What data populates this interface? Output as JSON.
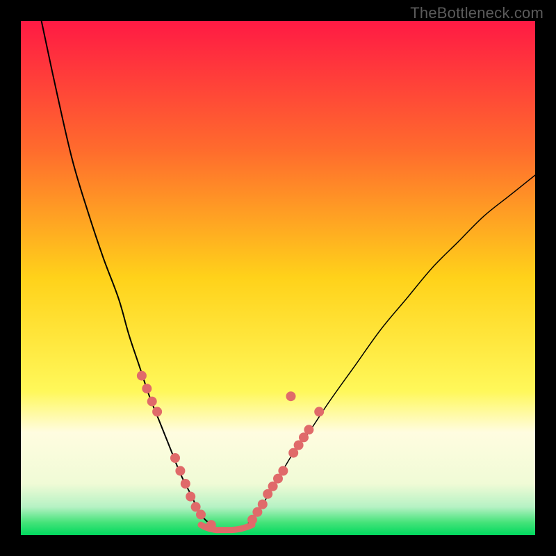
{
  "watermark": "TheBottleneck.com",
  "chart_data": {
    "type": "line",
    "title": "",
    "xlabel": "",
    "ylabel": "",
    "xlim": [
      0,
      100
    ],
    "ylim": [
      0,
      100
    ],
    "grid": false,
    "legend": false,
    "background_gradient": {
      "plot_area_only": true,
      "stops": [
        {
          "position": 0.0,
          "color": "#ff1a44"
        },
        {
          "position": 0.25,
          "color": "#ff6b2d"
        },
        {
          "position": 0.5,
          "color": "#ffd21a"
        },
        {
          "position": 0.72,
          "color": "#fff85a"
        },
        {
          "position": 0.8,
          "color": "#fffce0"
        },
        {
          "position": 0.9,
          "color": "#f0fbd6"
        },
        {
          "position": 0.945,
          "color": "#b6f2c4"
        },
        {
          "position": 0.975,
          "color": "#46e37a"
        },
        {
          "position": 1.0,
          "color": "#00d95e"
        }
      ]
    },
    "series": [
      {
        "name": "left-curve",
        "type": "line",
        "color": "#000000",
        "width": 2,
        "x": [
          4,
          7,
          10,
          13,
          16,
          19,
          21,
          23,
          25,
          27,
          29,
          31,
          33,
          35,
          37
        ],
        "y": [
          100,
          86,
          73,
          63,
          54,
          46,
          39,
          33,
          27,
          22,
          17,
          12,
          8,
          4,
          2
        ]
      },
      {
        "name": "right-curve",
        "type": "line",
        "color": "#000000",
        "width": 1.5,
        "x": [
          44,
          47,
          50,
          53,
          56,
          60,
          65,
          70,
          75,
          80,
          85,
          90,
          95,
          100
        ],
        "y": [
          2,
          6,
          11,
          16,
          20,
          26,
          33,
          40,
          46,
          52,
          57,
          62,
          66,
          70
        ]
      },
      {
        "name": "valley-floor",
        "type": "line",
        "color": "#e06a6a",
        "width": 9,
        "x": [
          35,
          36,
          37,
          38,
          39,
          40,
          41,
          42,
          43,
          44,
          45
        ],
        "y": [
          2,
          1.5,
          1.2,
          1,
          1,
          1,
          1,
          1.1,
          1.3,
          1.6,
          2
        ]
      },
      {
        "name": "left-dots",
        "type": "scatter",
        "color": "#e06a6a",
        "marker_radius": 7,
        "x": [
          23.5,
          24.5,
          25.5,
          26.5,
          30,
          31,
          32,
          33,
          34,
          35,
          37
        ],
        "y": [
          31,
          28.5,
          26,
          24,
          15,
          12.5,
          10,
          7.5,
          5.5,
          4,
          2
        ]
      },
      {
        "name": "right-dots",
        "type": "scatter",
        "color": "#e06a6a",
        "marker_radius": 7,
        "x": [
          45,
          46,
          47,
          48,
          49,
          50,
          51,
          53,
          54,
          55,
          56,
          58
        ],
        "y": [
          3,
          4.5,
          6,
          8,
          9.5,
          11,
          12.5,
          16,
          17.5,
          19,
          20.5,
          24
        ]
      },
      {
        "name": "stray-dot",
        "type": "scatter",
        "color": "#e06a6a",
        "marker_radius": 7,
        "x": [
          52.5
        ],
        "y": [
          27
        ]
      }
    ]
  }
}
